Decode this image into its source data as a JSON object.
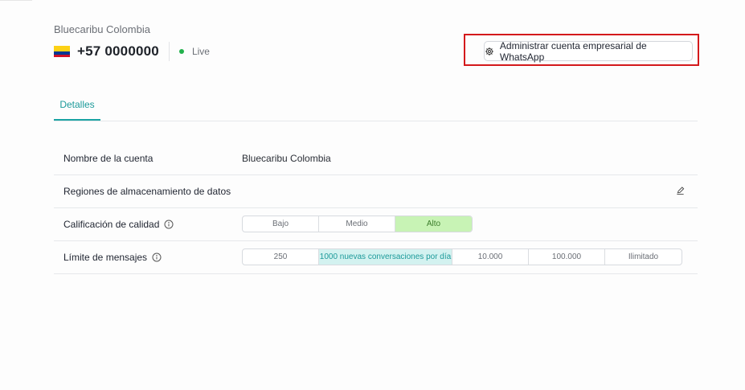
{
  "header": {
    "account_name": "Bluecaribu Colombia",
    "phone": "+57 0000000",
    "status": "Live",
    "status_color": "#22b14c",
    "manage_button_label": "Administrar cuenta empresarial de WhatsApp"
  },
  "tabs": [
    {
      "label": "Detalles",
      "active": true
    }
  ],
  "details": {
    "account_name_label": "Nombre de la cuenta",
    "account_name_value": "Bluecaribu Colombia",
    "storage_label": "Regiones de almacenamiento de datos",
    "quality_label": "Calificación de calidad",
    "quality_options": [
      "Bajo",
      "Medio",
      "Alto"
    ],
    "quality_selected": "Alto",
    "limit_label": "Límite de mensajes",
    "limit_options": [
      "250",
      "1000 nuevas conversaciones por día",
      "10.000",
      "100.000",
      "Ilimitado"
    ],
    "limit_selected": "1000 nuevas conversaciones por día"
  },
  "colors": {
    "accent": "#1aa3a3",
    "highlight_border": "#d4191b",
    "quality_active_bg": "#c8f3b5",
    "limit_active_bg": "#d3f2f0"
  }
}
